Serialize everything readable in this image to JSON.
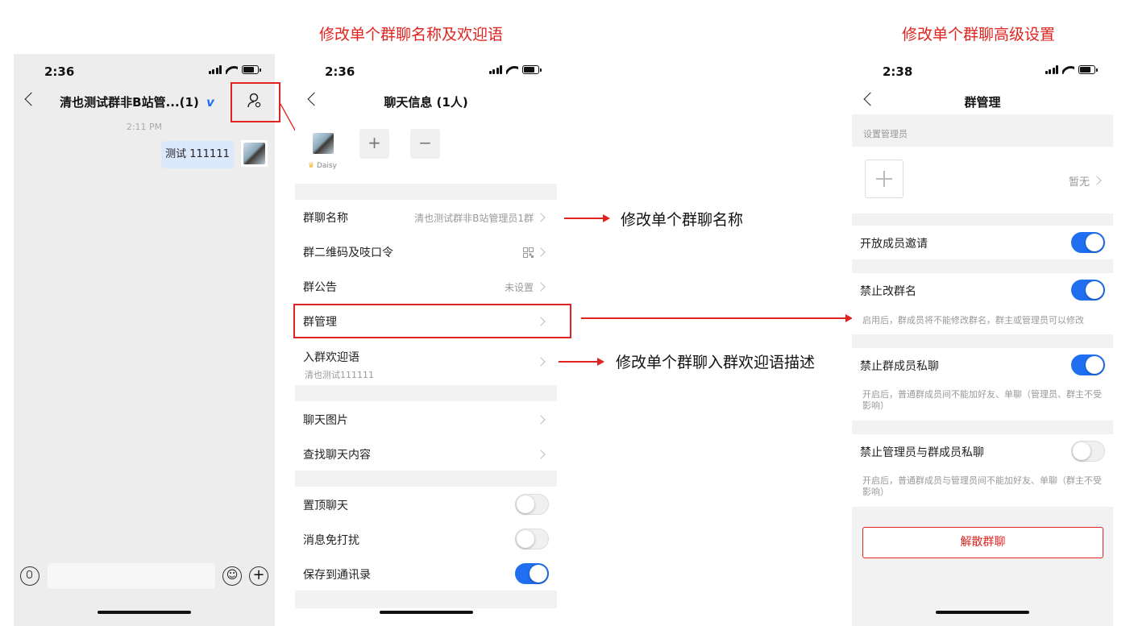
{
  "headings": {
    "middle": "修改单个群聊名称及欢迎语",
    "right": "修改单个群聊高级设置"
  },
  "annotations": {
    "name": "修改单个群聊名称",
    "welcome": "修改单个群聊入群欢迎语描述"
  },
  "colors": {
    "accent_red": "#e0231f",
    "toggle_on": "#1f6ff0",
    "bubble": "#dce8fb",
    "bg_gray": "#f2f2f2"
  },
  "phone1": {
    "time": "2:36",
    "title": "清也测试群非B站管...(1)",
    "verified_badge": "v",
    "timestamp": "2:11 PM",
    "message": "测试 111111",
    "icons": [
      "back-icon",
      "group-member-icon",
      "voice-icon",
      "emoji-icon",
      "plus-circle-icon"
    ]
  },
  "phone2": {
    "time": "2:36",
    "title": "聊天信息 (1人)",
    "member_name": "Daisy",
    "add_symbol": "+",
    "remove_symbol": "−",
    "rows": {
      "group_name": {
        "label": "群聊名称",
        "value": "清也测试群非B站管理员1群"
      },
      "qr": {
        "label": "群二维码及吱口令"
      },
      "notice": {
        "label": "群公告",
        "value": "未设置"
      },
      "manage": {
        "label": "群管理"
      },
      "welcome": {
        "label": "入群欢迎语",
        "sub": "清也测试111111"
      },
      "images": {
        "label": "聊天图片"
      },
      "search": {
        "label": "查找聊天内容"
      },
      "pin": {
        "label": "置顶聊天",
        "on": false
      },
      "mute": {
        "label": "消息免打扰",
        "on": false
      },
      "save": {
        "label": "保存到通讯录",
        "on": true
      }
    }
  },
  "phone3": {
    "time": "2:38",
    "title": "群管理",
    "admin_section": "设置管理员",
    "admin_value": "暂无",
    "invite": {
      "label": "开放成员邀请",
      "on": true
    },
    "rename": {
      "label": "禁止改群名",
      "on": true,
      "note": "启用后，群成员将不能修改群名，群主或管理员可以修改"
    },
    "private": {
      "label": "禁止群成员私聊",
      "on": true,
      "note": "开启后，普通群成员间不能加好友、单聊（管理员、群主不受影响）"
    },
    "admin_private": {
      "label": "禁止管理员与群成员私聊",
      "on": false,
      "note": "开启后，普通群成员与管理员间不能加好友、单聊（群主不受影响）"
    },
    "dissolve": "解散群聊"
  }
}
